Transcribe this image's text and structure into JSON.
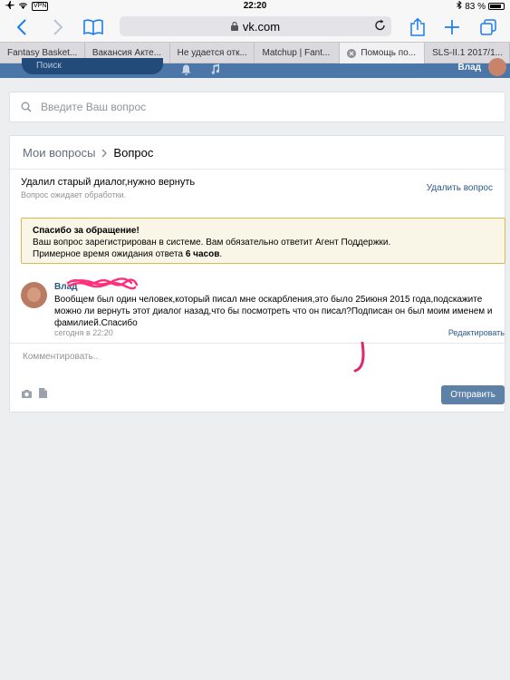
{
  "status_bar": {
    "vpn_label": "VPN",
    "time": "22:20",
    "battery_text": "83 %",
    "battery_level": 0.83
  },
  "browser": {
    "url": "vk.com",
    "tabs": [
      {
        "label": "Fantasy Basket...",
        "active": false
      },
      {
        "label": "Вакансия Акте...",
        "active": false
      },
      {
        "label": "Не удается отк...",
        "active": false
      },
      {
        "label": "Matchup | Fant...",
        "active": false
      },
      {
        "label": "Помощь по...",
        "active": true
      },
      {
        "label": "SLS-II.1 2017/1...",
        "active": false
      }
    ]
  },
  "vk_header": {
    "search_label": "Поиск",
    "user_name": "Влад"
  },
  "ask": {
    "placeholder": "Введите Ваш вопрос"
  },
  "breadcrumb": {
    "parent": "Мои вопросы",
    "current": "Вопрос"
  },
  "question": {
    "title": "Удалил старый диалог,нужно вернуть",
    "status": "Вопрос ожидает обработки.",
    "delete_label": "Удалить вопрос"
  },
  "notice": {
    "title": "Спасибо за обращение!",
    "line1": "Ваш вопрос зарегистрирован в системе. Вам обязательно ответит Агент Поддержки.",
    "line2_prefix": "Примерное время ожидания ответа ",
    "line2_bold": "6 часов",
    "line2_suffix": "."
  },
  "message": {
    "author": "Влад",
    "text": "Вообщем был один человек,который писал мне оскарбления,это было 25июня 2015 года,подскажите можно ли вернуть этот диалог назад,что бы посмотреть что он писал?Подписан он был моим именем и фамилией.Спасибо",
    "time": "сегодня в 22:20",
    "edit_label": "Редактировать"
  },
  "comment": {
    "placeholder": "Комментировать.."
  },
  "actions": {
    "send_label": "Отправить"
  },
  "colors": {
    "vk_blue": "#4a76a8",
    "link": "#2a5885",
    "ios_blue": "#1a7cf5",
    "notice_bg": "#f9f6e7",
    "notice_border": "#d4bc4c",
    "scribble_pink": "#ff2d7a"
  },
  "icons": [
    "airplane-icon",
    "wifi-icon",
    "bluetooth-icon",
    "back-icon",
    "forward-icon",
    "bookmarks-icon",
    "lock-icon",
    "reload-icon",
    "share-icon",
    "new-tab-icon",
    "tabs-icon",
    "close-tab-icon",
    "search-icon",
    "bell-icon",
    "music-icon",
    "chevron-right-icon",
    "camera-icon",
    "document-icon"
  ]
}
